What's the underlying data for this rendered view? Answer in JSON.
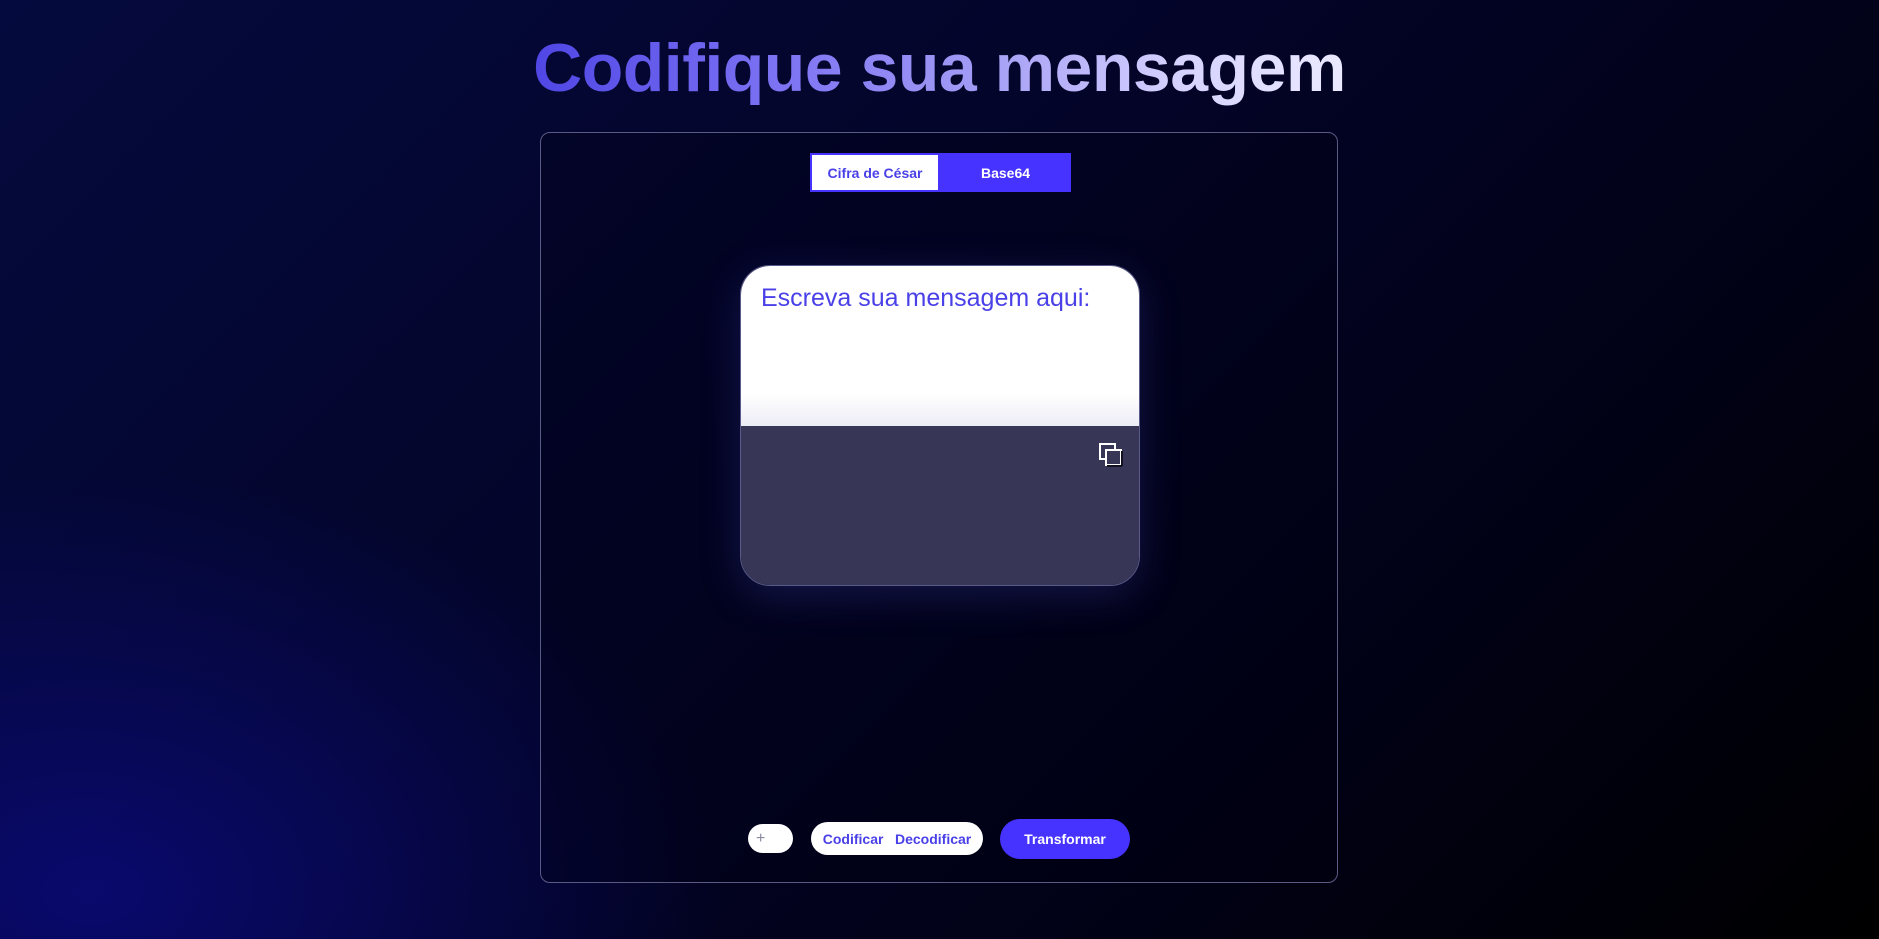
{
  "header": {
    "title": "Codifique sua mensagem"
  },
  "tabs": [
    {
      "label": "Cifra de César",
      "active": false
    },
    {
      "label": "Base64",
      "active": true
    }
  ],
  "message": {
    "placeholder": "Escreva sua mensagem aqui:",
    "value": ""
  },
  "output": {
    "value": "",
    "copy_icon": "copy-icon"
  },
  "controls": {
    "shift_symbol": "+",
    "mode_options": [
      "Codificar",
      "Decodificar"
    ],
    "transform_label": "Transformar"
  },
  "colors": {
    "accent": "#4733ff",
    "text_accent": "#4a40e8",
    "output_bg": "#383657"
  }
}
